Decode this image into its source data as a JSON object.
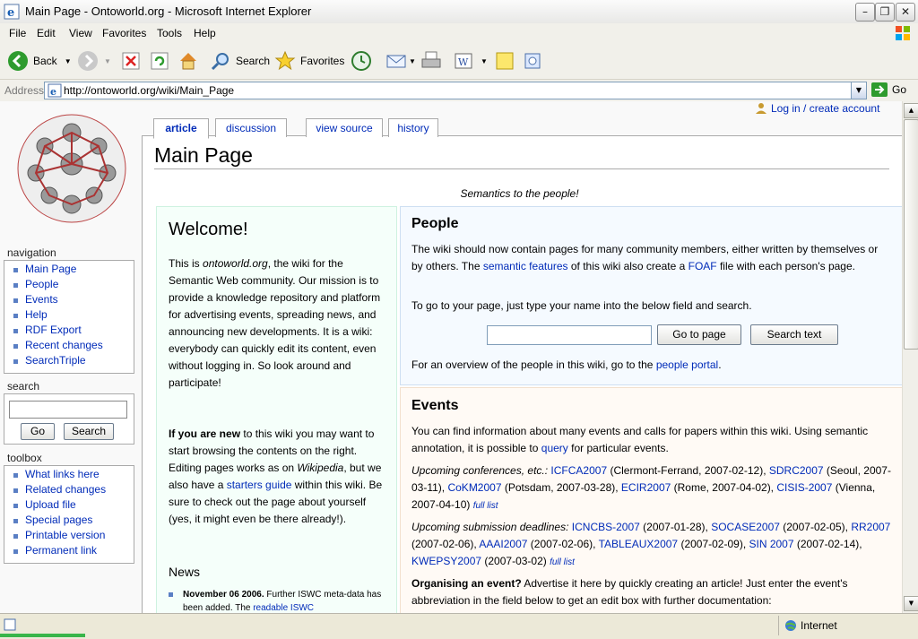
{
  "window": {
    "title": "Main Page - Ontoworld.org - Microsoft Internet Explorer"
  },
  "menu": [
    "File",
    "Edit",
    "View",
    "Favorites",
    "Tools",
    "Help"
  ],
  "toolbar": {
    "back": "Back",
    "search": "Search",
    "favorites": "Favorites"
  },
  "address": {
    "label": "Address",
    "url": "http://ontoworld.org/wiki/Main_Page",
    "go": "Go"
  },
  "status": {
    "zone": "Internet"
  },
  "wiki": {
    "login": "Log in / create account",
    "tabs": [
      "article",
      "discussion",
      "view source",
      "history"
    ],
    "page_title": "Main Page",
    "tagline": "Semantics to the people!",
    "navigation": {
      "heading": "navigation",
      "items": [
        "Main Page",
        "People",
        "Events",
        "Help",
        "RDF Export",
        "Recent changes",
        "SearchTriple"
      ]
    },
    "search": {
      "heading": "search",
      "go": "Go",
      "search": "Search"
    },
    "toolbox": {
      "heading": "toolbox",
      "items": [
        "What links here",
        "Related changes",
        "Upload file",
        "Special pages",
        "Printable version",
        "Permanent link"
      ]
    },
    "welcome": {
      "heading": "Welcome!",
      "p1_a": "This is ",
      "p1_em": "ontoworld.org",
      "p1_b": ", the wiki for the Semantic Web community. Our mission is to provide a knowledge repository and platform for advertising events, spreading news, and announcing new developments. It is a wiki: everybody can quickly edit its content, even without logging in. So look around and participate!",
      "p2_bold": "If you are new",
      "p2_a": " to this wiki you may want to start browsing the contents on the right. Editing pages works as on ",
      "p2_em": "Wikipedia",
      "p2_b": ", but we also have a ",
      "p2_link": "starters guide",
      "p2_c": " within this wiki. Be sure to check out the page about yourself (yes, it might even be there already!).",
      "news_heading": "News",
      "news_date": "November 06 2006.",
      "news_text": " Further ISWC meta-data has been added. The ",
      "news_link": "readable ISWC"
    },
    "people": {
      "heading": "People",
      "p1_a": "The wiki should now contain pages for many community members, either written by themselves or by others. The ",
      "p1_link1": "semantic features",
      "p1_b": " of this wiki also create a ",
      "p1_link2": "FOAF",
      "p1_c": " file with each person's page.",
      "p2": "To go to your page, just type your name into the below field and search.",
      "go_button": "Go to page",
      "search_button": "Search text",
      "p3_a": "For an overview of the people in this wiki, go to the ",
      "p3_link": "people portal",
      "p3_b": "."
    },
    "events": {
      "heading": "Events",
      "p1_a": "You can find information about many events and calls for papers within this wiki. Using semantic annotation, it is possible to ",
      "p1_link": "query",
      "p1_b": " for particular events.",
      "conf_label": "Upcoming conferences, etc.:",
      "conferences": [
        {
          "name": "ICFCA2007",
          "info": " (Clermont-Ferrand, 2007-02-12), "
        },
        {
          "name": "SDRC2007",
          "info": " (Seoul, 2007-03-11), "
        },
        {
          "name": "CoKM2007",
          "info": " (Potsdam, 2007-03-28), "
        },
        {
          "name": "ECIR2007",
          "info": " (Rome, 2007-04-02), "
        },
        {
          "name": "CISIS-2007",
          "info": " (Vienna, 2007-04-10) "
        }
      ],
      "full_list": "full list",
      "deadline_label": "Upcoming submission deadlines:",
      "deadlines": [
        {
          "name": "ICNCBS-2007",
          "info": " (2007-01-28), "
        },
        {
          "name": "SOCASE2007",
          "info": " (2007-02-05), "
        },
        {
          "name": "RR2007",
          "info": " (2007-02-06), "
        },
        {
          "name": "AAAI2007",
          "info": " (2007-02-06), "
        },
        {
          "name": "TABLEAUX2007",
          "info": " (2007-02-09), "
        },
        {
          "name": "SIN 2007",
          "info": " (2007-02-14), "
        },
        {
          "name": "KWEPSY2007",
          "info": " (2007-03-02) "
        }
      ],
      "organise_bold": "Organising an event?",
      "organise_text": " Advertise it here by quickly creating an article! Just enter the event's abbreviation in the field below to get an edit box with further documentation:"
    }
  }
}
